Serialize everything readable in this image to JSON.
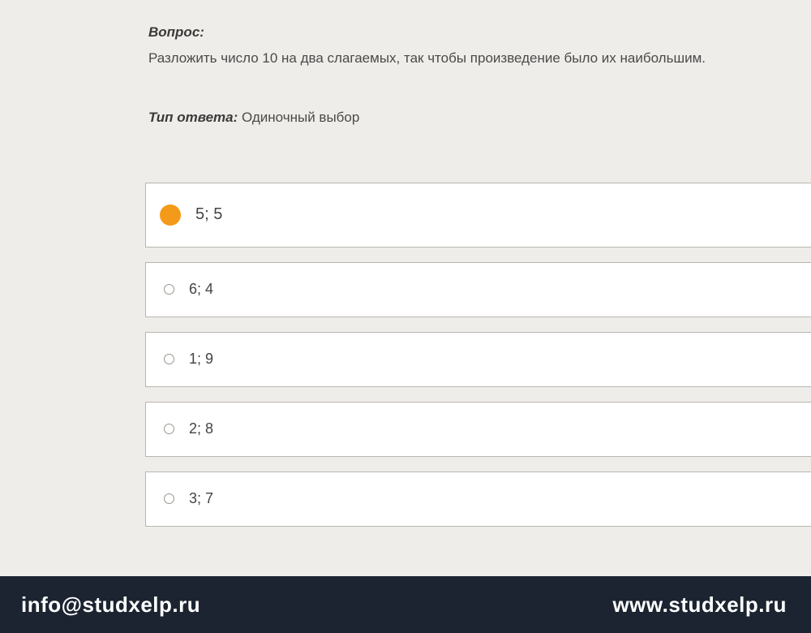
{
  "question": {
    "label": "Вопрос:",
    "text": "Разложить число 10 на два слагаемых, так чтобы произведение было их наибольшим.",
    "answer_type_label": "Тип ответа:",
    "answer_type_value": "Одиночный выбор"
  },
  "options": [
    {
      "label": "5; 5",
      "selected": true
    },
    {
      "label": "6; 4",
      "selected": false
    },
    {
      "label": "1; 9",
      "selected": false
    },
    {
      "label": "2; 8",
      "selected": false
    },
    {
      "label": "3; 7",
      "selected": false
    }
  ],
  "footer": {
    "email": "info@studxelp.ru",
    "site": "www.studxelp.ru"
  }
}
